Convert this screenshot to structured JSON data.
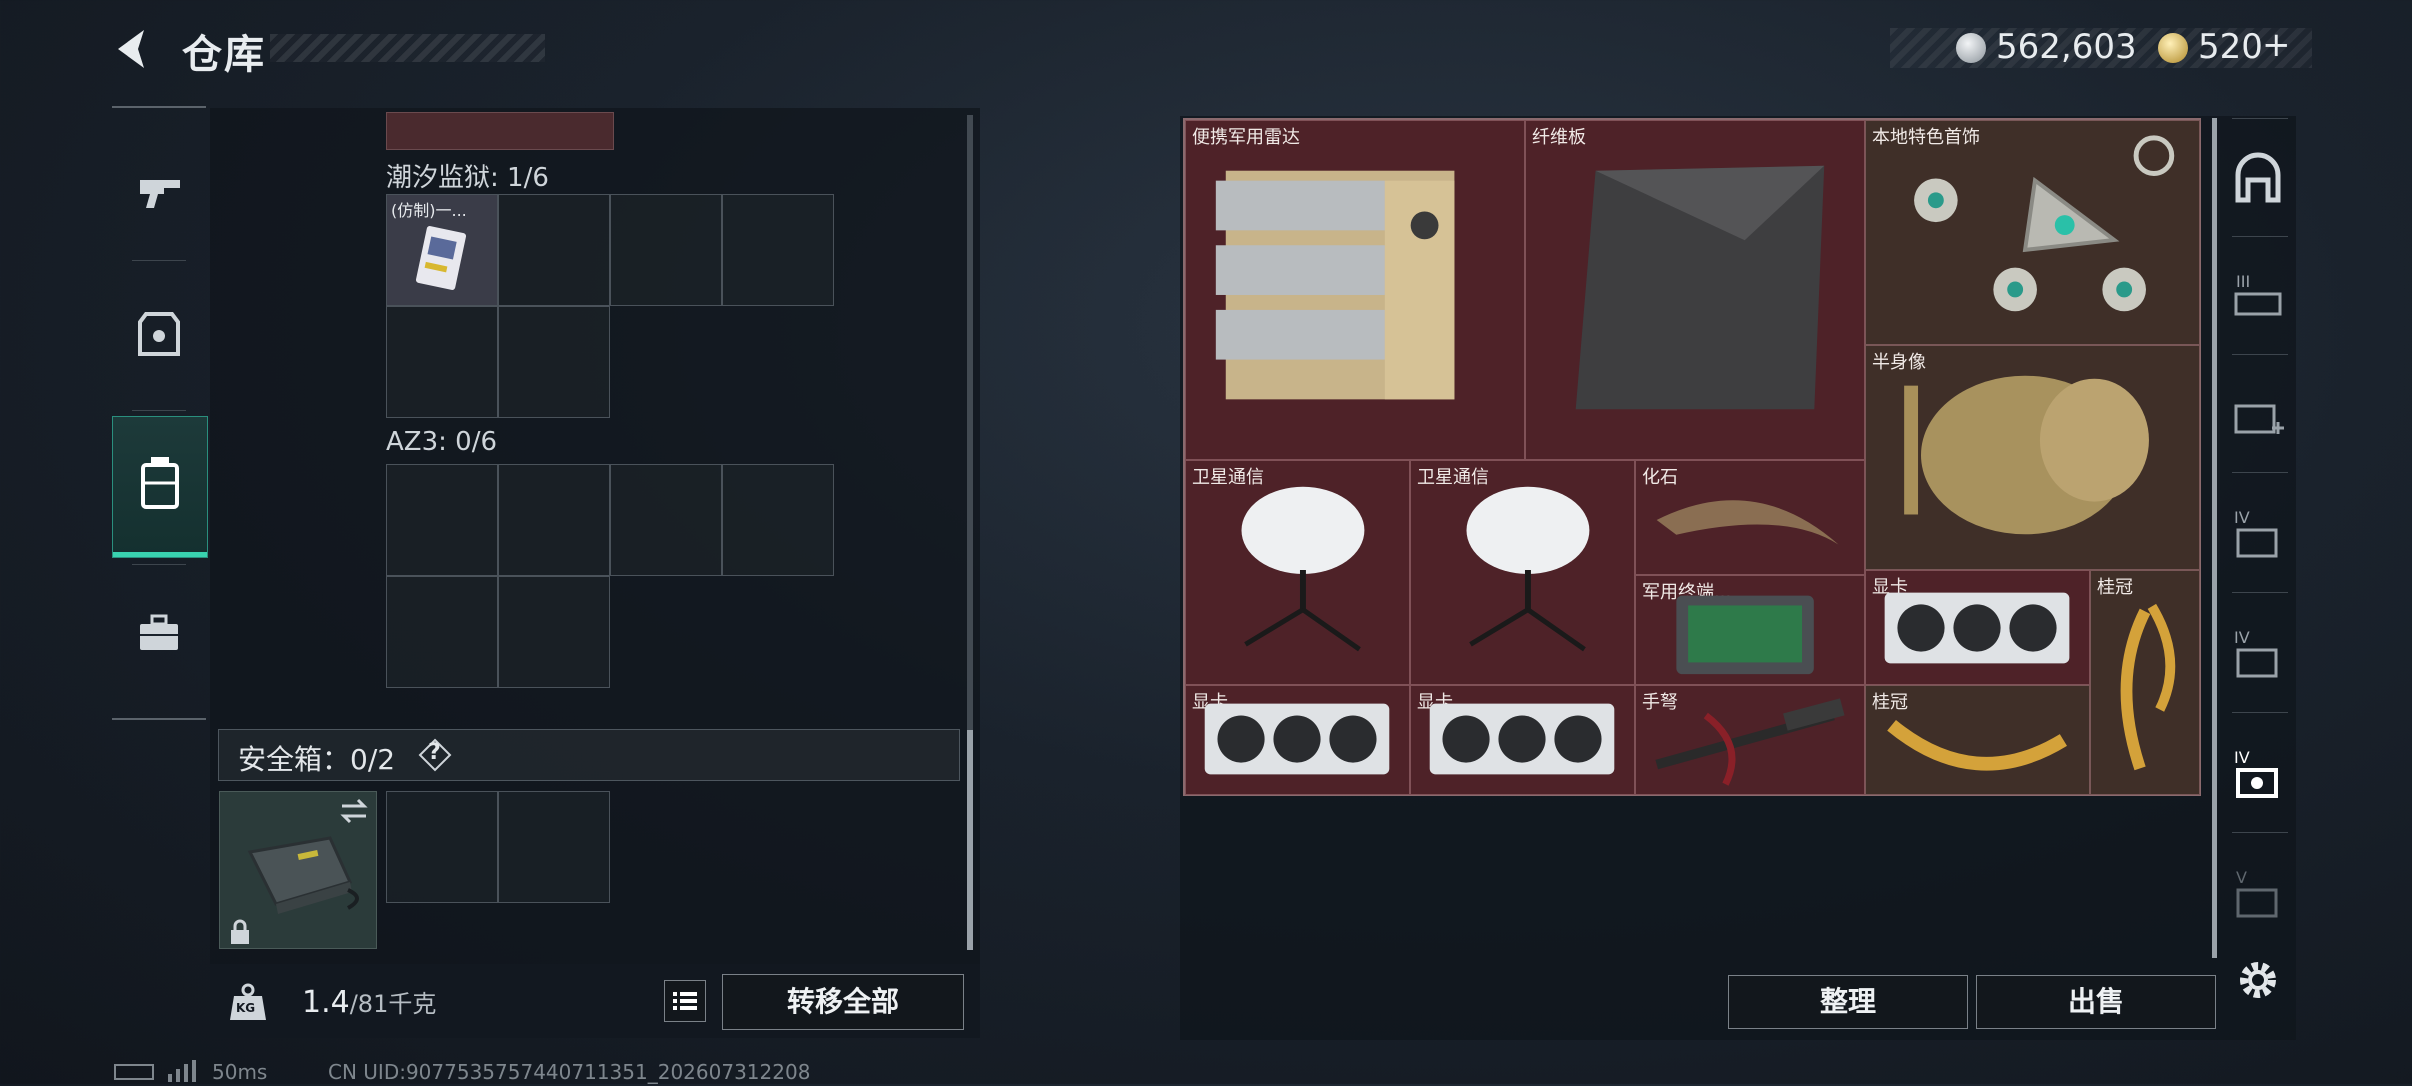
{
  "header": {
    "title": "仓库",
    "silver_amount": "562,603",
    "gold_amount": "520",
    "gold_plus": "+"
  },
  "left_tabs": [
    {
      "icon": "pistol-icon",
      "active": false
    },
    {
      "icon": "armor-icon",
      "active": false
    },
    {
      "icon": "backpack-icon",
      "active": true
    },
    {
      "icon": "toolbox-icon",
      "active": false
    }
  ],
  "containers": {
    "tidal_prison": {
      "label": "潮汐监狱: 1/6",
      "item_label": "(仿制)一..."
    },
    "az3": {
      "label": "AZ3: 0/6"
    }
  },
  "safe_box": {
    "label": "安全箱：0/2",
    "help": "?"
  },
  "weight": {
    "current": "1.4",
    "max": "/81千克",
    "icon_label": "KG"
  },
  "buttons": {
    "transfer_all": "转移全部",
    "sort": "整理",
    "sell": "出售"
  },
  "loot_items": [
    {
      "name": "便携军用雷达"
    },
    {
      "name": "纤维板"
    },
    {
      "name": "本地特色首饰"
    },
    {
      "name": "半身像"
    },
    {
      "name": "卫星通信"
    },
    {
      "name": "卫星通信"
    },
    {
      "name": "化石"
    },
    {
      "name": "军用终端..."
    },
    {
      "name": "显卡"
    },
    {
      "name": "桂冠"
    },
    {
      "name": "显卡"
    },
    {
      "name": "显卡"
    },
    {
      "name": "手弩"
    },
    {
      "name": "桂冠"
    }
  ],
  "right_tabs": [
    {
      "icon": "safehouse-icon"
    },
    {
      "icon": "storage-iii-icon",
      "label": "III"
    },
    {
      "icon": "medical-storage-icon"
    },
    {
      "icon": "storage-iv-icon",
      "label": "IV"
    },
    {
      "icon": "storage-iv-b-icon",
      "label": "IV"
    },
    {
      "icon": "storage-iv-active-icon",
      "label": "IV"
    },
    {
      "icon": "storage-v-icon",
      "label": "V"
    }
  ],
  "status": {
    "ping": "50ms",
    "uid": "CN UID:9077535757440711351_202607312208"
  },
  "colors": {
    "accent": "#39d3b0",
    "loot_bg": "#4e2228",
    "gold_bg": "#3f2f28"
  }
}
